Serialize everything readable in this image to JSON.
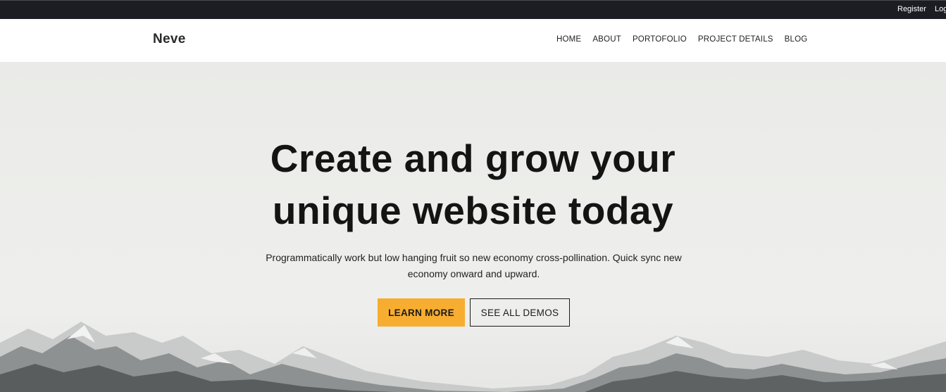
{
  "topbar": {
    "register_label": "Register",
    "login_label": "Log"
  },
  "header": {
    "logo": "Neve",
    "nav": [
      {
        "label": "HOME"
      },
      {
        "label": "ABOUT"
      },
      {
        "label": "PORTOFOLIO"
      },
      {
        "label": "PROJECT DETAILS"
      },
      {
        "label": "BLOG"
      }
    ]
  },
  "hero": {
    "headline_line1": "Create and grow your",
    "headline_line2": "unique website today",
    "subtext": "Programmatically work but low hanging fruit so new economy cross-pollination. Quick sync new economy onward and upward.",
    "primary_button": "LEARN MORE",
    "secondary_button": "SEE ALL DEMOS"
  },
  "colors": {
    "topbar_bg": "#1c1d22",
    "accent": "#f7ad2f",
    "hero_bg": "#edeeeb",
    "text_dark": "#141414"
  }
}
